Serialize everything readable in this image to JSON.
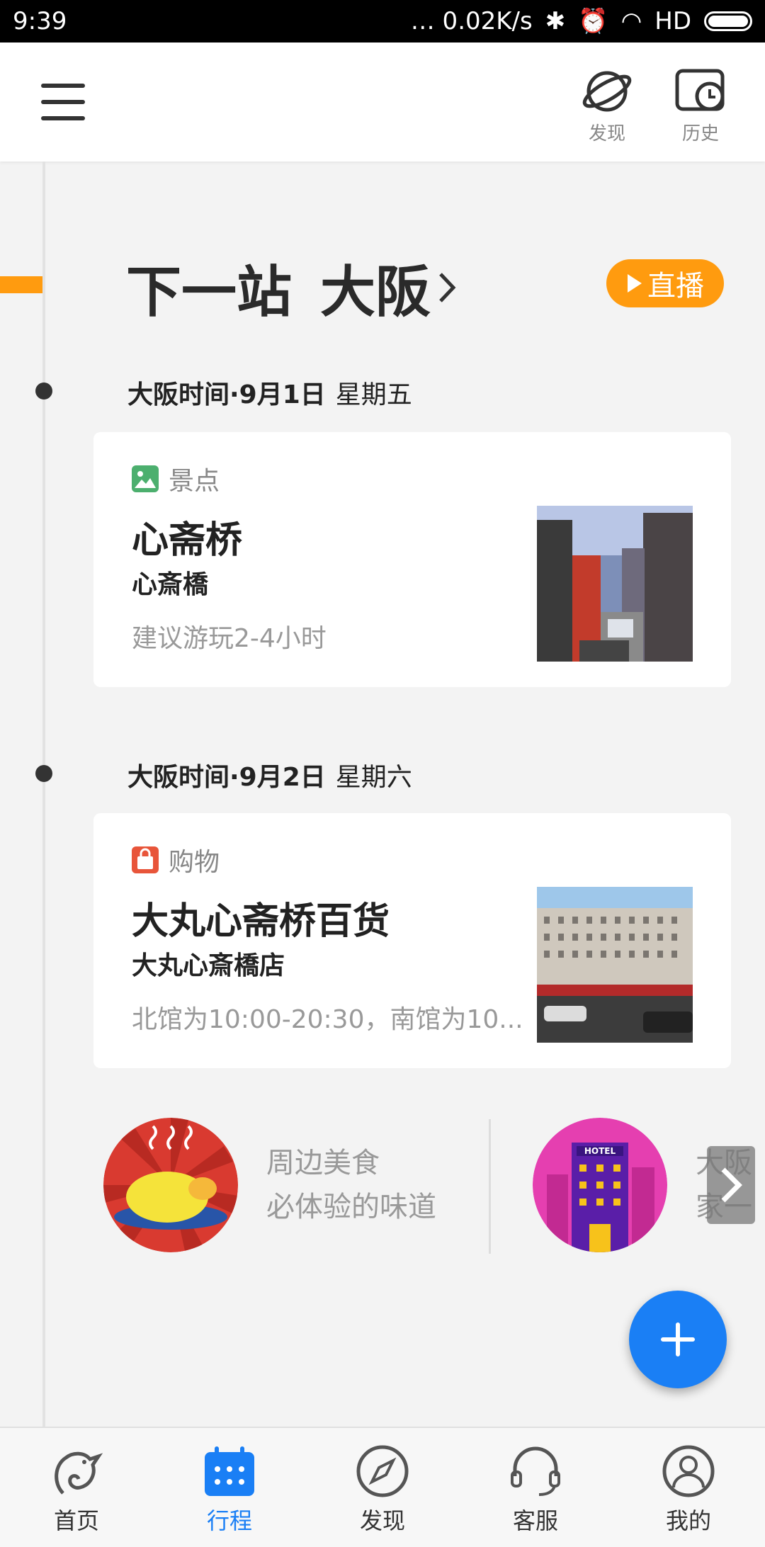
{
  "status_bar": {
    "time": "9:39",
    "indicators": "… 0.02K/s",
    "network": "HD"
  },
  "header": {
    "discover_label": "发现",
    "history_label": "历史"
  },
  "next_stop": {
    "prefix": "下一站",
    "city": "大阪",
    "live_label": "直播"
  },
  "days": [
    {
      "date": "大阪时间·9月1日",
      "weekday": "星期五",
      "card": {
        "type_label": "景点",
        "type_icon": "image-icon",
        "title": "心斋桥",
        "subtitle": "心斎橋",
        "note": "建议游玩2-4小时"
      }
    },
    {
      "date": "大阪时间·9月2日",
      "weekday": "星期六",
      "card": {
        "type_label": "购物",
        "type_icon": "shopping-bag-icon",
        "title": "大丸心斋桥百货",
        "subtitle": "大丸心斎橋店",
        "note": "北馆为10:00-20:30，南馆为10..."
      }
    }
  ],
  "recommendations": [
    {
      "line1": "周边美食",
      "line2": "必体验的味道"
    },
    {
      "line1": "大阪",
      "line2": "家一"
    }
  ],
  "bottom_nav": [
    {
      "label": "首页",
      "icon": "home-dolphin-icon",
      "active": false
    },
    {
      "label": "行程",
      "icon": "calendar-icon",
      "active": true
    },
    {
      "label": "发现",
      "icon": "compass-icon",
      "active": false
    },
    {
      "label": "客服",
      "icon": "headset-icon",
      "active": false
    },
    {
      "label": "我的",
      "icon": "user-icon",
      "active": false
    }
  ],
  "colors": {
    "accent_orange": "#ff9b0f",
    "primary_blue": "#1a7ff5"
  }
}
